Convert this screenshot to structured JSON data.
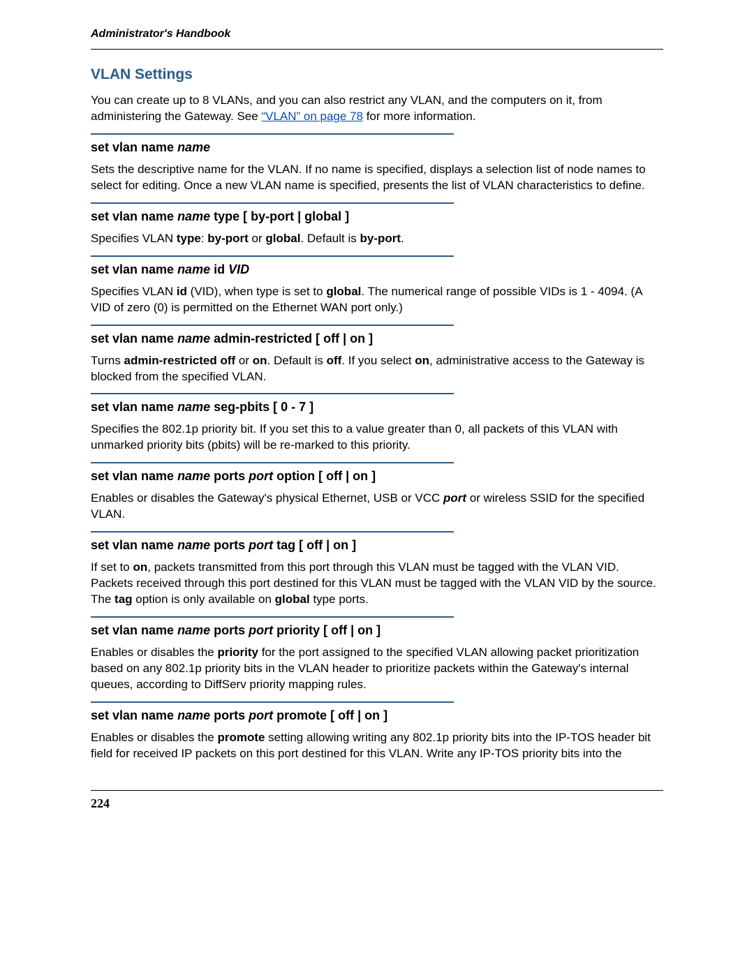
{
  "running_head": "Administrator's Handbook",
  "page_number": "224",
  "section_title": "VLAN Settings",
  "intro": {
    "pre": "You can create up to 8 VLANs, and you can also restrict any VLAN, and the computers on it, from administering the Gateway. See ",
    "link": "“VLAN” on page 78",
    "post": " for more information."
  },
  "entries": [
    {
      "head": [
        {
          "t": "set vlan name ",
          "cls": "b"
        },
        {
          "t": "name",
          "cls": "bi"
        }
      ],
      "desc": [
        {
          "t": "Sets the descriptive name for the VLAN. If no name is specified, displays a selection list of node names to select for editing. Once a new VLAN name is specified, presents the list of VLAN characteristics to define."
        }
      ]
    },
    {
      "head": [
        {
          "t": "set vlan name ",
          "cls": "b"
        },
        {
          "t": "name",
          "cls": "bi"
        },
        {
          "t": " type [ by-port | global ]",
          "cls": "b"
        }
      ],
      "desc": [
        {
          "t": "Specifies VLAN "
        },
        {
          "t": "type",
          "cls": "b"
        },
        {
          "t": ": "
        },
        {
          "t": "by-port",
          "cls": "b"
        },
        {
          "t": " or "
        },
        {
          "t": "global",
          "cls": "b"
        },
        {
          "t": ". Default is "
        },
        {
          "t": "by-port",
          "cls": "b"
        },
        {
          "t": "."
        }
      ]
    },
    {
      "head": [
        {
          "t": "set vlan name ",
          "cls": "b"
        },
        {
          "t": "name",
          "cls": "bi"
        },
        {
          "t": " id ",
          "cls": "b"
        },
        {
          "t": "VID",
          "cls": "bi"
        }
      ],
      "desc": [
        {
          "t": "Specifies VLAN "
        },
        {
          "t": "id",
          "cls": "b"
        },
        {
          "t": " (VID), when type is set to "
        },
        {
          "t": "global",
          "cls": "b"
        },
        {
          "t": ". The numerical range of possible VIDs is 1 - 4094. (A VID of zero (0) is permitted on the Ethernet WAN port only.)"
        }
      ]
    },
    {
      "head": [
        {
          "t": "set vlan name ",
          "cls": "b"
        },
        {
          "t": "name",
          "cls": "bi"
        },
        {
          "t": " admin-restricted [ off | on ]",
          "cls": "b"
        }
      ],
      "desc": [
        {
          "t": "Turns "
        },
        {
          "t": "admin-restricted off",
          "cls": "b"
        },
        {
          "t": " or "
        },
        {
          "t": "on",
          "cls": "b"
        },
        {
          "t": ". Default is "
        },
        {
          "t": "off",
          "cls": "b"
        },
        {
          "t": ". If you select "
        },
        {
          "t": "on",
          "cls": "b"
        },
        {
          "t": ", administrative access to the Gateway is blocked from the specified VLAN."
        }
      ]
    },
    {
      "head": [
        {
          "t": "set vlan name ",
          "cls": "b"
        },
        {
          "t": "name",
          "cls": "bi"
        },
        {
          "t": " seg-pbits [ 0 - 7 ]",
          "cls": "b"
        }
      ],
      "desc": [
        {
          "t": "Specifies the 802.1p priority bit. If you set this to a value greater than 0, all packets of this VLAN with unmarked priority bits (pbits) will be re-marked to this priority."
        }
      ]
    },
    {
      "head": [
        {
          "t": "set vlan name ",
          "cls": "b"
        },
        {
          "t": "name",
          "cls": "bi"
        },
        {
          "t": " ports ",
          "cls": "b"
        },
        {
          "t": "port",
          "cls": "bi"
        },
        {
          "t": " option [ off | on ]",
          "cls": "b"
        }
      ],
      "desc": [
        {
          "t": "Enables or disables the Gateway's physical Ethernet, USB or VCC "
        },
        {
          "t": "port",
          "cls": "bi"
        },
        {
          "t": " or wireless SSID for the specified VLAN."
        }
      ]
    },
    {
      "head": [
        {
          "t": "set vlan name ",
          "cls": "b"
        },
        {
          "t": "name",
          "cls": "bi"
        },
        {
          "t": " ports ",
          "cls": "b"
        },
        {
          "t": "port",
          "cls": "bi"
        },
        {
          "t": " tag [ off | on ]",
          "cls": "b"
        }
      ],
      "desc": [
        {
          "t": "If set to "
        },
        {
          "t": "on",
          "cls": "b"
        },
        {
          "t": ", packets transmitted from this port through this VLAN must be tagged with the VLAN VID. Packets received through this port destined for this VLAN must be tagged with the VLAN VID by the source. The "
        },
        {
          "t": "tag",
          "cls": "b"
        },
        {
          "t": " option is only available on "
        },
        {
          "t": "global",
          "cls": "b"
        },
        {
          "t": " type ports."
        }
      ]
    },
    {
      "head": [
        {
          "t": "set vlan name ",
          "cls": "b"
        },
        {
          "t": "name",
          "cls": "bi"
        },
        {
          "t": " ports ",
          "cls": "b"
        },
        {
          "t": "port",
          "cls": "bi"
        },
        {
          "t": " priority [ off | on ]",
          "cls": "b"
        }
      ],
      "desc": [
        {
          "t": "Enables or disables the "
        },
        {
          "t": "priority",
          "cls": "b"
        },
        {
          "t": " for the port assigned to the specified VLAN allowing packet prioritization based on any 802.1p priority bits in the VLAN header to prioritize packets within the Gateway's internal queues, according to DiffServ priority mapping rules."
        }
      ]
    },
    {
      "head": [
        {
          "t": "set vlan name ",
          "cls": "b"
        },
        {
          "t": "name",
          "cls": "bi"
        },
        {
          "t": " ports ",
          "cls": "b"
        },
        {
          "t": "port",
          "cls": "bi"
        },
        {
          "t": " promote [ off | on ]",
          "cls": "b"
        }
      ],
      "desc": [
        {
          "t": "Enables or disables the "
        },
        {
          "t": "promote",
          "cls": "b"
        },
        {
          "t": " setting allowing writing any 802.1p priority bits into the IP-TOS header bit field for received IP packets on this port destined for this VLAN. Write any IP-TOS priority bits into the"
        }
      ]
    }
  ]
}
